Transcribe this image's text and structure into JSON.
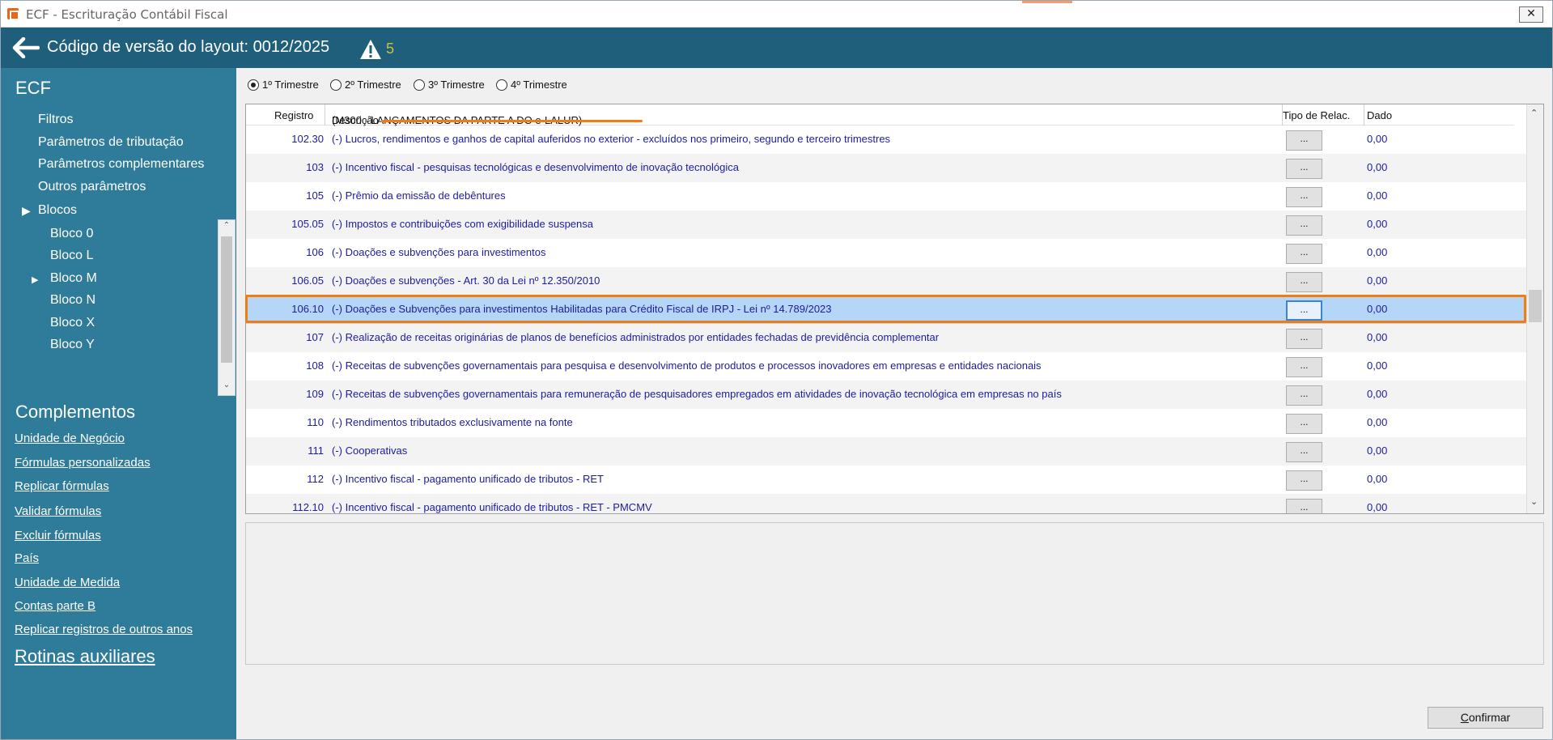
{
  "window": {
    "title": "ECF - Escrituração Contábil Fiscal",
    "close_label": "✕"
  },
  "header": {
    "layout_code": "Código de versão do layout: 0012/2025",
    "warning_count": "5",
    "accent_color": "#205f7b"
  },
  "sidebar": {
    "title": "ECF",
    "items": [
      {
        "label": "Filtros"
      },
      {
        "label": "Parâmetros de tributação"
      },
      {
        "label": "Parâmetros complementares"
      },
      {
        "label": "Outros parâmetros"
      },
      {
        "label": "Blocos"
      },
      {
        "label": "Bloco 0"
      },
      {
        "label": "Bloco L"
      },
      {
        "label": "Bloco M"
      },
      {
        "label": "Bloco N"
      },
      {
        "label": "Bloco X"
      },
      {
        "label": "Bloco Y"
      }
    ],
    "complementos_title": "Complementos",
    "links": [
      "Unidade de Negócio",
      "Fórmulas personalizadas",
      "Replicar fórmulas",
      "Validar fórmulas",
      "Excluir fórmulas",
      "País",
      "Unidade de Medida",
      "Contas parte B",
      "Replicar registros de outros anos"
    ],
    "rotinas_title": "Rotinas auxiliares"
  },
  "quarters": {
    "options": [
      "1º Trimestre",
      "2º Trimestre",
      "3º Trimestre",
      "4º Trimestre"
    ],
    "selected": "1º Trimestre"
  },
  "grid": {
    "columns": {
      "registro": "Registro",
      "descricao": "Descrição",
      "descricao_section": "(M300 - LANÇAMENTOS DA PARTE A DO e-LALUR)",
      "tipo": "Tipo de Relac.",
      "dado": "Dado"
    },
    "button_label": "...",
    "rows": [
      {
        "reg": "102.30",
        "desc": "(-) Lucros, rendimentos e ganhos de capital auferidos no exterior - excluídos nos primeiro, segundo e terceiro trimestres",
        "val": "0,00"
      },
      {
        "reg": "103",
        "desc": "(-) Incentivo fiscal - pesquisas tecnológicas e desenvolvimento de inovação tecnológica",
        "val": "0,00"
      },
      {
        "reg": "105",
        "desc": "(-) Prêmio da emissão de debêntures",
        "val": "0,00"
      },
      {
        "reg": "105.05",
        "desc": "(-) Impostos e contribuições com exigibilidade suspensa",
        "val": "0,00"
      },
      {
        "reg": "106",
        "desc": "(-) Doações e subvenções para investimentos",
        "val": "0,00"
      },
      {
        "reg": "106.05",
        "desc": "(-) Doações e subvenções - Art. 30 da Lei nº 12.350/2010",
        "val": "0,00"
      },
      {
        "reg": "106.10",
        "desc": "(-) Doações e Subvenções para investimentos Habilitadas para Crédito Fiscal de IRPJ - Lei nº 14.789/2023",
        "val": "0,00"
      },
      {
        "reg": "107",
        "desc": "(-) Realização de receitas originárias de planos de benefícios administrados por entidades fechadas de previdência complementar",
        "val": "0,00"
      },
      {
        "reg": "108",
        "desc": "(-) Receitas de subvenções governamentais para pesquisa e desenvolvimento de produtos e processos inovadores em empresas e entidades nacionais",
        "val": "0,00"
      },
      {
        "reg": "109",
        "desc": "(-) Receitas de subvenções governamentais para remuneração de pesquisadores empregados em atividades de inovação tecnológica em empresas no país",
        "val": "0,00"
      },
      {
        "reg": "110",
        "desc": "(-) Rendimentos tributados exclusivamente na fonte",
        "val": "0,00"
      },
      {
        "reg": "111",
        "desc": "(-) Cooperativas",
        "val": "0,00"
      },
      {
        "reg": "112",
        "desc": "(-) Incentivo fiscal - pagamento unificado de tributos - RET",
        "val": "0,00"
      },
      {
        "reg": "112.10",
        "desc": "(-) Incentivo fiscal - pagamento unificado de tributos - RET - PMCMV",
        "val": "0,00"
      }
    ],
    "selected_registro": "106.10",
    "highlight_color": "#f07d10"
  },
  "footer": {
    "confirm_first": "C",
    "confirm_rest": "onfirmar"
  }
}
